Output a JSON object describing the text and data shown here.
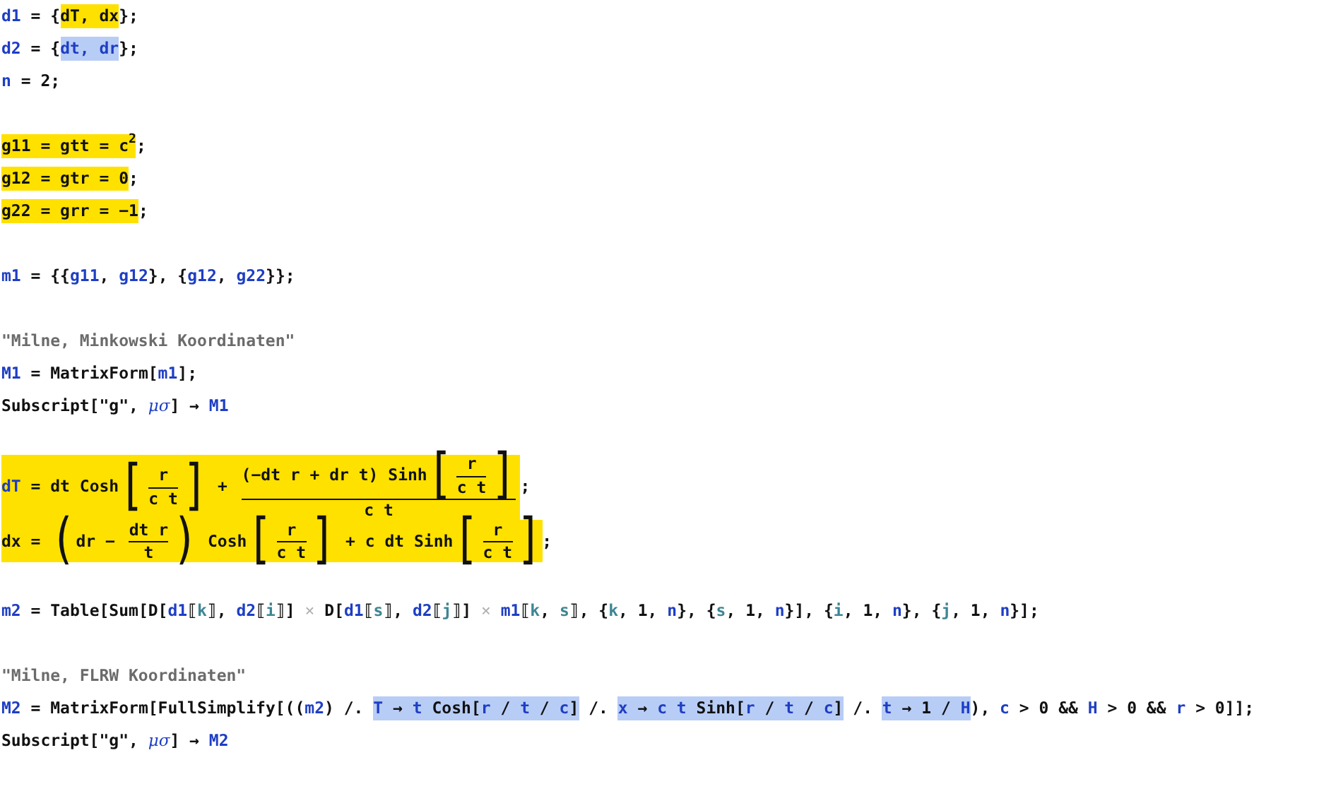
{
  "notebook": {
    "lines": [
      {
        "kind": "code",
        "parts": [
          {
            "kind": "symbol",
            "text": "d1"
          },
          {
            "kind": "plain",
            "text": " = {"
          },
          {
            "kind": "highlight",
            "parts": [
              {
                "kind": "plain",
                "text": "dT, dx"
              }
            ]
          },
          {
            "kind": "plain",
            "text": "};"
          }
        ]
      },
      {
        "kind": "code",
        "parts": [
          {
            "kind": "symbol",
            "text": "d2"
          },
          {
            "kind": "plain",
            "text": " = {"
          },
          {
            "kind": "selection",
            "parts": [
              {
                "kind": "symbol",
                "text": "dt, dr"
              }
            ]
          },
          {
            "kind": "plain",
            "text": "};"
          }
        ]
      },
      {
        "kind": "code",
        "parts": [
          {
            "kind": "symbol",
            "text": "n"
          },
          {
            "kind": "plain",
            "text": " = 2;"
          }
        ]
      },
      {
        "kind": "blank"
      },
      {
        "kind": "code",
        "parts": [
          {
            "kind": "highlight",
            "parts": [
              {
                "kind": "plain",
                "text": "g11 = gtt = c$^{2}$"
              }
            ]
          },
          {
            "kind": "plain",
            "text": ";"
          }
        ]
      },
      {
        "kind": "code",
        "parts": [
          {
            "kind": "highlight",
            "parts": [
              {
                "kind": "plain",
                "text": "g12 = gtr = 0"
              }
            ]
          },
          {
            "kind": "plain",
            "text": ";"
          }
        ]
      },
      {
        "kind": "code",
        "parts": [
          {
            "kind": "highlight",
            "parts": [
              {
                "kind": "plain",
                "text": "g22 = grr = −1"
              }
            ]
          },
          {
            "kind": "plain",
            "text": ";"
          }
        ]
      },
      {
        "kind": "blank"
      },
      {
        "kind": "code",
        "parts": [
          {
            "kind": "symbol",
            "text": "m1"
          },
          {
            "kind": "plain",
            "text": " = {{"
          },
          {
            "kind": "symbol",
            "text": "g11"
          },
          {
            "kind": "plain",
            "text": ", "
          },
          {
            "kind": "symbol",
            "text": "g12"
          },
          {
            "kind": "plain",
            "text": "}, {"
          },
          {
            "kind": "symbol",
            "text": "g12"
          },
          {
            "kind": "plain",
            "text": ", "
          },
          {
            "kind": "symbol",
            "text": "g22"
          },
          {
            "kind": "plain",
            "text": "}};"
          }
        ]
      },
      {
        "kind": "blank"
      },
      {
        "kind": "code",
        "parts": [
          {
            "kind": "string",
            "text": "\"Milne, Minkowski Koordinaten\""
          }
        ]
      },
      {
        "kind": "code",
        "parts": [
          {
            "kind": "symbol",
            "text": "M1"
          },
          {
            "kind": "plain",
            "text": " = MatrixForm["
          },
          {
            "kind": "symbol",
            "text": "m1"
          },
          {
            "kind": "plain",
            "text": "];"
          }
        ]
      },
      {
        "kind": "code",
        "parts": [
          {
            "kind": "plain",
            "text": "Subscript[\"g\", "
          },
          {
            "kind": "greek",
            "text": "μσ"
          },
          {
            "kind": "plain",
            "text": "] → "
          },
          {
            "kind": "symbol",
            "text": "M1"
          }
        ]
      },
      {
        "kind": "blank"
      },
      {
        "kind": "code",
        "parts": [
          {
            "kind": "highlight",
            "parts": [
              {
                "kind": "symbol",
                "text": "dT"
              },
              {
                "kind": "plain",
                "text": " = dt Cosh"
              },
              {
                "kind": "bracket",
                "open": "[",
                "close": "]",
                "parts": [
                  {
                    "kind": "frac",
                    "num": [
                      {
                        "kind": "plain",
                        "text": "r"
                      }
                    ],
                    "den": [
                      {
                        "kind": "plain",
                        "text": "c t"
                      }
                    ]
                  }
                ]
              },
              {
                "kind": "plain",
                "text": " + "
              },
              {
                "kind": "frac",
                "num": [
                  {
                    "kind": "plain",
                    "text": "(−dt r + dr t) Sinh"
                  },
                  {
                    "kind": "bracket",
                    "open": "[",
                    "close": "]",
                    "parts": [
                      {
                        "kind": "frac",
                        "num": [
                          {
                            "kind": "plain",
                            "text": "r"
                          }
                        ],
                        "den": [
                          {
                            "kind": "plain",
                            "text": "c t"
                          }
                        ]
                      }
                    ]
                  }
                ],
                "den": [
                  {
                    "kind": "plain",
                    "text": "c t"
                  }
                ]
              }
            ]
          },
          {
            "kind": "plain",
            "text": ";"
          }
        ]
      },
      {
        "kind": "code",
        "parts": [
          {
            "kind": "highlight",
            "parts": [
              {
                "kind": "plain",
                "text": "dx = "
              },
              {
                "kind": "bracket",
                "open": "(",
                "close": ")",
                "parts": [
                  {
                    "kind": "plain",
                    "text": "dr − "
                  },
                  {
                    "kind": "frac",
                    "num": [
                      {
                        "kind": "plain",
                        "text": "dt r"
                      }
                    ],
                    "den": [
                      {
                        "kind": "plain",
                        "text": "t"
                      }
                    ]
                  }
                ]
              },
              {
                "kind": "plain",
                "text": " Cosh"
              },
              {
                "kind": "bracket",
                "open": "[",
                "close": "]",
                "parts": [
                  {
                    "kind": "frac",
                    "num": [
                      {
                        "kind": "plain",
                        "text": "r"
                      }
                    ],
                    "den": [
                      {
                        "kind": "plain",
                        "text": "c t"
                      }
                    ]
                  }
                ]
              },
              {
                "kind": "plain",
                "text": " + c dt Sinh"
              },
              {
                "kind": "bracket",
                "open": "[",
                "close": "]",
                "parts": [
                  {
                    "kind": "frac",
                    "num": [
                      {
                        "kind": "plain",
                        "text": "r"
                      }
                    ],
                    "den": [
                      {
                        "kind": "plain",
                        "text": "c t"
                      }
                    ]
                  }
                ]
              }
            ]
          },
          {
            "kind": "plain",
            "text": ";"
          }
        ]
      },
      {
        "kind": "blank"
      },
      {
        "kind": "code",
        "parts": [
          {
            "kind": "symbol",
            "text": "m2"
          },
          {
            "kind": "plain",
            "text": " = Table[Sum[D["
          },
          {
            "kind": "symbol",
            "text": "d1"
          },
          {
            "kind": "plain",
            "text": "⟦"
          },
          {
            "kind": "local",
            "text": "k"
          },
          {
            "kind": "plain",
            "text": "⟧, "
          },
          {
            "kind": "symbol",
            "text": "d2"
          },
          {
            "kind": "plain",
            "text": "⟦"
          },
          {
            "kind": "local",
            "text": "i"
          },
          {
            "kind": "plain",
            "text": "⟧] "
          },
          {
            "kind": "faint",
            "text": "×"
          },
          {
            "kind": "plain",
            "text": " D["
          },
          {
            "kind": "symbol",
            "text": "d1"
          },
          {
            "kind": "plain",
            "text": "⟦"
          },
          {
            "kind": "local",
            "text": "s"
          },
          {
            "kind": "plain",
            "text": "⟧, "
          },
          {
            "kind": "symbol",
            "text": "d2"
          },
          {
            "kind": "plain",
            "text": "⟦"
          },
          {
            "kind": "local",
            "text": "j"
          },
          {
            "kind": "plain",
            "text": "⟧] "
          },
          {
            "kind": "faint",
            "text": "×"
          },
          {
            "kind": "symbol",
            "text": " m1"
          },
          {
            "kind": "plain",
            "text": "⟦"
          },
          {
            "kind": "local",
            "text": "k"
          },
          {
            "kind": "plain",
            "text": ", "
          },
          {
            "kind": "local",
            "text": "s"
          },
          {
            "kind": "plain",
            "text": "⟧, {"
          },
          {
            "kind": "local",
            "text": "k"
          },
          {
            "kind": "plain",
            "text": ", 1, "
          },
          {
            "kind": "symbol",
            "text": "n"
          },
          {
            "kind": "plain",
            "text": "}, {"
          },
          {
            "kind": "local",
            "text": "s"
          },
          {
            "kind": "plain",
            "text": ", 1, "
          },
          {
            "kind": "symbol",
            "text": "n"
          },
          {
            "kind": "plain",
            "text": "}], {"
          },
          {
            "kind": "local",
            "text": "i"
          },
          {
            "kind": "plain",
            "text": ", 1, "
          },
          {
            "kind": "symbol",
            "text": "n"
          },
          {
            "kind": "plain",
            "text": "}, {"
          },
          {
            "kind": "local",
            "text": "j"
          },
          {
            "kind": "plain",
            "text": ", 1, "
          },
          {
            "kind": "symbol",
            "text": "n"
          },
          {
            "kind": "plain",
            "text": "}];"
          }
        ]
      },
      {
        "kind": "blank"
      },
      {
        "kind": "code",
        "parts": [
          {
            "kind": "string",
            "text": "\"Milne, FLRW Koordinaten\""
          }
        ]
      },
      {
        "kind": "code",
        "parts": [
          {
            "kind": "symbol",
            "text": "M2"
          },
          {
            "kind": "plain",
            "text": " = MatrixForm[FullSimplify[(("
          },
          {
            "kind": "symbol",
            "text": "m2"
          },
          {
            "kind": "plain",
            "text": ") /. "
          },
          {
            "kind": "selection",
            "parts": [
              {
                "kind": "symbol",
                "text": "T"
              },
              {
                "kind": "plain",
                "text": " → "
              },
              {
                "kind": "symbol",
                "text": "t"
              },
              {
                "kind": "plain",
                "text": " Cosh["
              },
              {
                "kind": "symbol",
                "text": "r"
              },
              {
                "kind": "plain",
                "text": " / "
              },
              {
                "kind": "symbol",
                "text": "t"
              },
              {
                "kind": "plain",
                "text": " / "
              },
              {
                "kind": "symbol",
                "text": "c"
              },
              {
                "kind": "plain",
                "text": "]"
              }
            ]
          },
          {
            "kind": "plain",
            "text": " /. "
          },
          {
            "kind": "selection",
            "parts": [
              {
                "kind": "symbol",
                "text": "x"
              },
              {
                "kind": "plain",
                "text": " → "
              },
              {
                "kind": "symbol",
                "text": "c t"
              },
              {
                "kind": "plain",
                "text": " Sinh["
              },
              {
                "kind": "symbol",
                "text": "r"
              },
              {
                "kind": "plain",
                "text": " / "
              },
              {
                "kind": "symbol",
                "text": "t"
              },
              {
                "kind": "plain",
                "text": " / "
              },
              {
                "kind": "symbol",
                "text": "c"
              },
              {
                "kind": "plain",
                "text": "]"
              }
            ]
          },
          {
            "kind": "plain",
            "text": " /. "
          },
          {
            "kind": "selection",
            "parts": [
              {
                "kind": "symbol",
                "text": "t"
              },
              {
                "kind": "plain",
                "text": " → 1 / "
              },
              {
                "kind": "symbol",
                "text": "H"
              }
            ]
          },
          {
            "kind": "plain",
            "text": "), "
          },
          {
            "kind": "symbol",
            "text": "c"
          },
          {
            "kind": "plain",
            "text": " > 0 && "
          },
          {
            "kind": "symbol",
            "text": "H"
          },
          {
            "kind": "plain",
            "text": " > 0 && "
          },
          {
            "kind": "symbol",
            "text": "r"
          },
          {
            "kind": "plain",
            "text": " > 0]];"
          }
        ]
      },
      {
        "kind": "code",
        "parts": [
          {
            "kind": "plain",
            "text": "Subscript[\"g\", "
          },
          {
            "kind": "greek",
            "text": "μσ"
          },
          {
            "kind": "plain",
            "text": "] → "
          },
          {
            "kind": "symbol",
            "text": "M2"
          }
        ]
      }
    ]
  }
}
